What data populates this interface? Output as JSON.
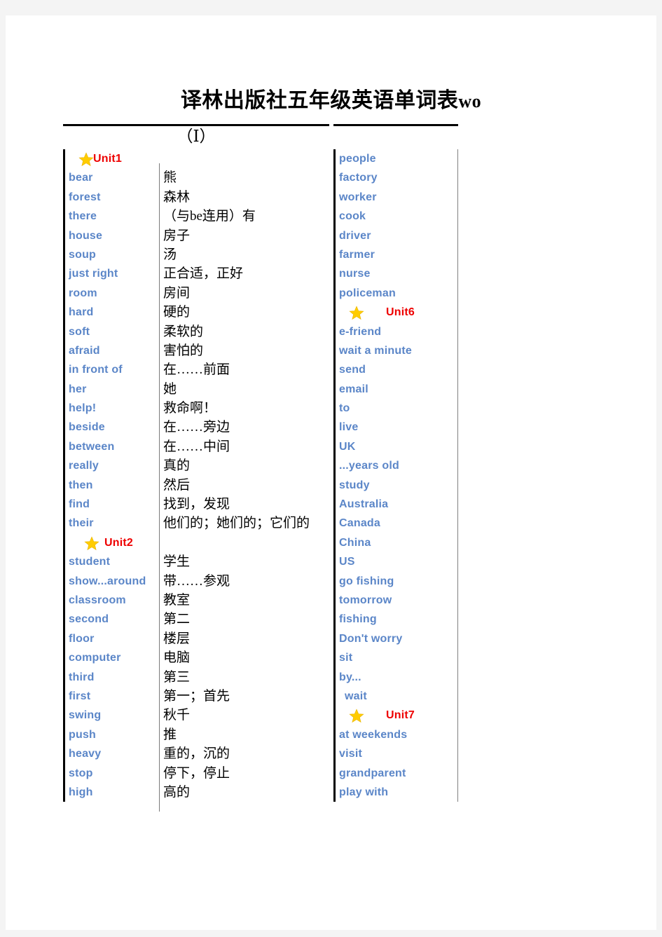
{
  "document": {
    "title_cjk": "译林出版社五年级英语单词表",
    "title_latin": "wo",
    "section_header": "（Ⅰ）"
  },
  "colors": {
    "english_word": "#5b86c8",
    "unit_label": "#ee0000",
    "translation": "#000000",
    "star": "#ffcc00",
    "page_background": "#ffffff",
    "canvas_background": "#f4f4f4"
  },
  "icons": {
    "star": "star-icon"
  },
  "left_column": {
    "rows": [
      {
        "type": "unit",
        "label": "Unit1",
        "icon": "star-icon"
      },
      {
        "type": "word",
        "en": "bear",
        "cn": "熊"
      },
      {
        "type": "word",
        "en": "forest",
        "cn": "森林"
      },
      {
        "type": "word",
        "en": "there",
        "cn": "（与be连用）有"
      },
      {
        "type": "word",
        "en": "house",
        "cn": "房子"
      },
      {
        "type": "word",
        "en": "soup",
        "cn": "汤"
      },
      {
        "type": "word",
        "en": "just right",
        "cn": "正合适，正好"
      },
      {
        "type": "word",
        "en": "room",
        "cn": "房间"
      },
      {
        "type": "word",
        "en": "hard",
        "cn": "硬的"
      },
      {
        "type": "word",
        "en": "soft",
        "cn": "柔软的"
      },
      {
        "type": "word",
        "en": "afraid",
        "cn": "害怕的"
      },
      {
        "type": "word",
        "en": "in front of",
        "cn": "在……前面"
      },
      {
        "type": "word",
        "en": "her",
        "cn": "她"
      },
      {
        "type": "word",
        "en": "help!",
        "cn": "救命啊！"
      },
      {
        "type": "word",
        "en": "beside",
        "cn": "在……旁边"
      },
      {
        "type": "word",
        "en": "between",
        "cn": "在……中间"
      },
      {
        "type": "word",
        "en": "really",
        "cn": "真的"
      },
      {
        "type": "word",
        "en": "then",
        "cn": "然后"
      },
      {
        "type": "word",
        "en": "find",
        "cn": "找到，发现"
      },
      {
        "type": "word",
        "en": "their",
        "cn": "他们的；她们的；它们的"
      },
      {
        "type": "unit",
        "label": "Unit2",
        "icon": "star-icon",
        "pad": true
      },
      {
        "type": "word",
        "en": "student",
        "cn": "学生"
      },
      {
        "type": "word",
        "en": "show...around",
        "cn": "带……参观"
      },
      {
        "type": "word",
        "en": "classroom",
        "cn": "教室"
      },
      {
        "type": "word",
        "en": "second",
        "cn": "第二"
      },
      {
        "type": "word",
        "en": "floor",
        "cn": "楼层"
      },
      {
        "type": "word",
        "en": "computer",
        "cn": "电脑"
      },
      {
        "type": "word",
        "en": "third",
        "cn": "第三"
      },
      {
        "type": "word",
        "en": "first",
        "cn": "第一；首先"
      },
      {
        "type": "word",
        "en": "swing",
        "cn": "秋千"
      },
      {
        "type": "word",
        "en": "push",
        "cn": "推"
      },
      {
        "type": "word",
        "en": "heavy",
        "cn": "重的，沉的"
      },
      {
        "type": "word",
        "en": "stop",
        "cn": "停下，停止"
      },
      {
        "type": "word",
        "en": "high",
        "cn": "高的"
      }
    ]
  },
  "right_column": {
    "rows": [
      {
        "type": "word",
        "en": "people"
      },
      {
        "type": "word",
        "en": "factory"
      },
      {
        "type": "word",
        "en": "worker"
      },
      {
        "type": "word",
        "en": "cook"
      },
      {
        "type": "word",
        "en": "driver"
      },
      {
        "type": "word",
        "en": "farmer"
      },
      {
        "type": "word",
        "en": "nurse"
      },
      {
        "type": "word",
        "en": "policeman"
      },
      {
        "type": "unit",
        "label": "Unit6",
        "icon": "star-icon"
      },
      {
        "type": "word",
        "en": "e-friend"
      },
      {
        "type": "word",
        "en": "wait a minute"
      },
      {
        "type": "word",
        "en": "send"
      },
      {
        "type": "word",
        "en": "email"
      },
      {
        "type": "word",
        "en": "to"
      },
      {
        "type": "word",
        "en": "live"
      },
      {
        "type": "word",
        "en": "UK"
      },
      {
        "type": "word",
        "en": "...years old"
      },
      {
        "type": "word",
        "en": "study"
      },
      {
        "type": "word",
        "en": "Australia"
      },
      {
        "type": "word",
        "en": "Canada"
      },
      {
        "type": "word",
        "en": "China"
      },
      {
        "type": "word",
        "en": "US"
      },
      {
        "type": "word",
        "en": "go fishing"
      },
      {
        "type": "word",
        "en": "tomorrow"
      },
      {
        "type": "word",
        "en": "fishing"
      },
      {
        "type": "word",
        "en": "Don't worry"
      },
      {
        "type": "word",
        "en": "sit"
      },
      {
        "type": "word",
        "en": "by..."
      },
      {
        "type": "word",
        "en": "wait",
        "indent": true
      },
      {
        "type": "unit",
        "label": "Unit7",
        "icon": "star-icon"
      },
      {
        "type": "word",
        "en": "at weekends"
      },
      {
        "type": "word",
        "en": "visit"
      },
      {
        "type": "word",
        "en": "grandparent"
      },
      {
        "type": "word",
        "en": "play with"
      }
    ]
  }
}
